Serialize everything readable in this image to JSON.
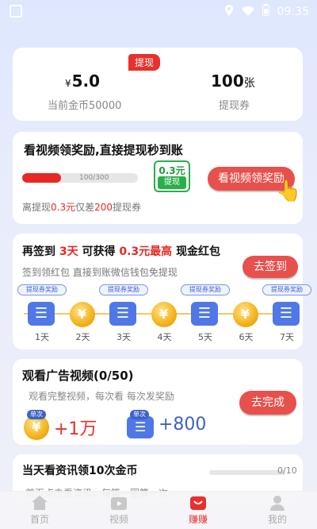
{
  "status": {
    "time": "09:35"
  },
  "balance": {
    "tag": "提现",
    "currency_symbol": "¥",
    "amount": "5.0",
    "coins_label": "当前金币50000",
    "tickets_amount": "100",
    "tickets_unit": "张",
    "tickets_label": "提现券"
  },
  "video_task": {
    "title": "看视频领奖励,直接提现秒到账",
    "progress_text": "100/300",
    "progress": 0.333,
    "reward_amount": "0.3元",
    "reward_button": "提现",
    "button_label": "看视频领奖励",
    "footer_prefix": "离提现",
    "footer_amount": "0.3元",
    "footer_mid": "仅差",
    "footer_count": "200",
    "footer_suffix": "提现券"
  },
  "signin": {
    "title_p1": "再签到",
    "title_days": "3天",
    "title_p2": "可获得",
    "title_amount": "0.3元最高",
    "title_p3": "现金红包",
    "subtitle": "签到领红包 直接到账微信钱包免提现",
    "button_label": "去签到",
    "days": [
      {
        "label": "1天",
        "type": "ticket",
        "tag": "提现券奖励"
      },
      {
        "label": "2天",
        "type": "coin",
        "tag": ""
      },
      {
        "label": "3天",
        "type": "ticket",
        "tag": "提现券奖励"
      },
      {
        "label": "4天",
        "type": "coin",
        "tag": ""
      },
      {
        "label": "5天",
        "type": "ticket",
        "tag": "提现券奖励"
      },
      {
        "label": "6天",
        "type": "coin",
        "tag": ""
      },
      {
        "label": "7天",
        "type": "ticket",
        "tag": "提现券奖励"
      }
    ]
  },
  "ads_task": {
    "title": "观看广告视频(0/50)",
    "subtitle": "观看完整视频，每次看 每次发奖励",
    "tag": "单次",
    "reward_coins": "+1万",
    "reward_tickets": "+800",
    "button_label": "去完成"
  },
  "news_task": {
    "title": "当天看资讯领10次金币",
    "subtitle": "首页点击看资讯，每篇一圈算一次",
    "count": "0/10"
  },
  "nav": {
    "items": [
      {
        "label": "首页",
        "icon": "home-icon"
      },
      {
        "label": "视频",
        "icon": "video-icon"
      },
      {
        "label": "赚赚",
        "icon": "earn-icon"
      },
      {
        "label": "我的",
        "icon": "profile-icon"
      }
    ]
  },
  "colors": {
    "accent_red": "#e8302c",
    "blue": "#3d62c8",
    "green": "#28b04a",
    "gold": "#f3b21b"
  }
}
